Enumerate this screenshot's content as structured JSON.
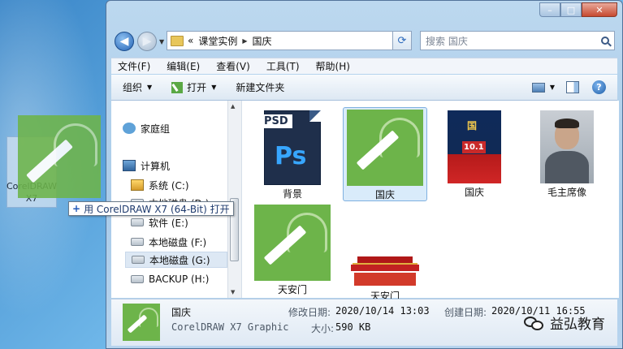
{
  "window": {
    "controls": [
      "–",
      "□",
      "✕"
    ]
  },
  "address": {
    "prefix": "«",
    "segments": [
      "课堂实例",
      "国庆"
    ],
    "separator": "▶",
    "search_placeholder": "搜索 国庆"
  },
  "menu": [
    "文件(F)",
    "编辑(E)",
    "查看(V)",
    "工具(T)",
    "帮助(H)"
  ],
  "toolbar": {
    "organize": "组织",
    "open": "打开",
    "new_folder": "新建文件夹",
    "help": "?"
  },
  "nav": {
    "homegroup": "家庭组",
    "computer": "计算机",
    "drives": [
      "系统 (C:)",
      "本地磁盘 (D:)",
      "软件 (E:)",
      "本地磁盘 (F:)",
      "本地磁盘 (G:)",
      "BACKUP (H:)"
    ]
  },
  "files": [
    {
      "name": "背景",
      "icon": "psd-icon",
      "badge": "PSD",
      "glyph": "Ps"
    },
    {
      "name": "国庆",
      "icon": "coreldraw-icon",
      "selected": true
    },
    {
      "name": "国庆",
      "icon": "poster-image"
    },
    {
      "name": "毛主席像",
      "icon": "portrait-image"
    },
    {
      "name": "天安门",
      "icon": "coreldraw-icon"
    },
    {
      "name": "天安门",
      "icon": "tiananmen-image"
    }
  ],
  "details": {
    "name": "国庆",
    "type": "CorelDRAW X7 Graphic",
    "modified_label": "修改日期:",
    "modified": "2020/10/14 13:03",
    "size_label": "大小:",
    "size": "590 KB",
    "created_label": "创建日期:",
    "created": "2020/10/11 16:55"
  },
  "drag": {
    "desktop_icon_label": "CorelDRAW X7",
    "tooltip": "用 CorelDRAW X7 (64-Bit) 打开"
  },
  "watermark": "益弘教育",
  "colors": {
    "corel_green": "#6db44a",
    "selection": "#d9ebfa",
    "ps_blue": "#37a6ff"
  }
}
